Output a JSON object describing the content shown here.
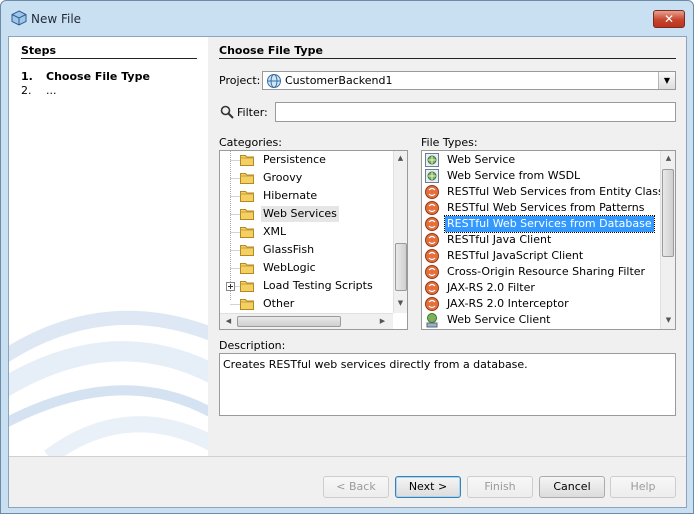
{
  "window": {
    "title": "New File",
    "close_glyph": "✕"
  },
  "steps": {
    "title": "Steps",
    "items": [
      {
        "num": "1.",
        "label": "Choose File Type"
      },
      {
        "num": "2.",
        "label": "..."
      }
    ]
  },
  "main": {
    "title": "Choose File Type",
    "project_label": "Project:",
    "project_value": "CustomerBackend1",
    "filter_label": "Filter:",
    "filter_value": "",
    "categories_label": "Categories:",
    "file_types_label": "File Types:",
    "description_label": "Description:",
    "description_text": "Creates RESTful web services directly from a database."
  },
  "categories": [
    {
      "label": "Persistence"
    },
    {
      "label": "Groovy"
    },
    {
      "label": "Hibernate"
    },
    {
      "label": "Web Services",
      "state": "highlighted"
    },
    {
      "label": "XML"
    },
    {
      "label": "GlassFish"
    },
    {
      "label": "WebLogic"
    },
    {
      "label": "Load Testing Scripts",
      "expandable": true
    },
    {
      "label": "Other"
    }
  ],
  "file_types": [
    {
      "label": "Web Service",
      "icon": "web-service-icon"
    },
    {
      "label": "Web Service from WSDL",
      "icon": "web-service-icon"
    },
    {
      "label": "RESTful Web Services from Entity Classes",
      "icon": "rest-icon"
    },
    {
      "label": "RESTful Web Services from Patterns",
      "icon": "rest-icon"
    },
    {
      "label": "RESTful Web Services from Database",
      "icon": "rest-icon",
      "state": "selected"
    },
    {
      "label": "RESTful Java Client",
      "icon": "rest-icon"
    },
    {
      "label": "RESTful JavaScript Client",
      "icon": "rest-icon"
    },
    {
      "label": "Cross-Origin Resource Sharing Filter",
      "icon": "rest-icon"
    },
    {
      "label": "JAX-RS 2.0 Filter",
      "icon": "rest-icon"
    },
    {
      "label": "JAX-RS 2.0 Interceptor",
      "icon": "rest-icon"
    },
    {
      "label": "Web Service Client",
      "icon": "ws-client-icon"
    }
  ],
  "buttons": {
    "back": "< Back",
    "next": "Next >",
    "finish": "Finish",
    "cancel": "Cancel",
    "help": "Help"
  },
  "button_states": {
    "back": "disabled",
    "next": "default",
    "finish": "disabled",
    "cancel": "enabled",
    "help": "disabled"
  },
  "colors": {
    "selection": "#3399ff",
    "window_frame": "#c9dff2",
    "close_button": "#c7452d"
  }
}
